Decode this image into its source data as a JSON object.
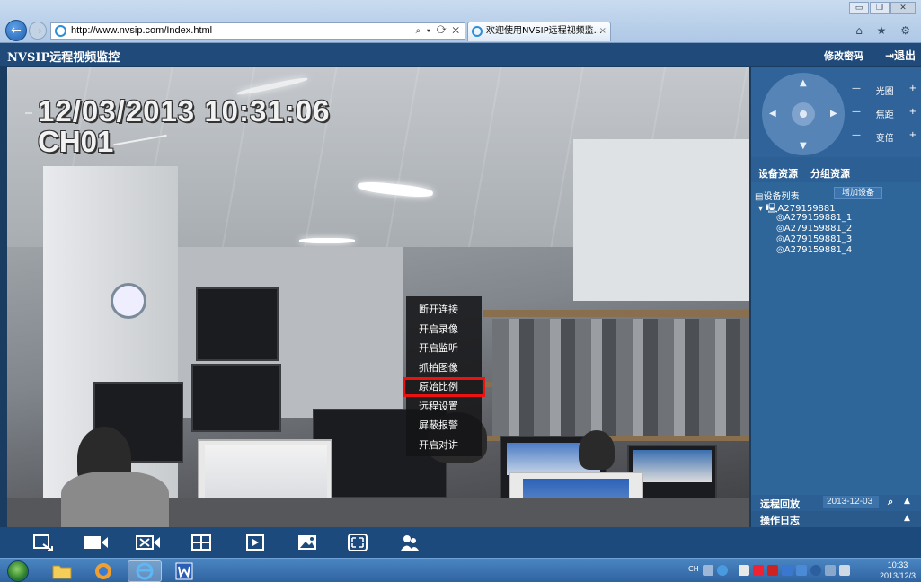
{
  "browser": {
    "address": "http://www.nvsip.com/Index.html",
    "address_tools": "⌕ ▾ ⟳ ✕",
    "tab_title": "欢迎使用NVSIP远程视频监...",
    "tab_close": "×",
    "min": "▭",
    "max": "❐",
    "close": "✕",
    "home_fav": "⌂ ★ ⚙"
  },
  "header": {
    "title": "NVSIP远程视频监控",
    "change_password": "修改密码",
    "logout": "⇥退出"
  },
  "video": {
    "osd_time": "12/03/2013 10:31:06",
    "osd_channel": "CH01"
  },
  "context_menu": {
    "items": [
      "断开连接",
      "开启录像",
      "开启监听",
      "抓拍图像",
      "原始比例",
      "远程设置",
      "屏蔽报警",
      "开启对讲"
    ],
    "highlighted_index": 4
  },
  "ptz": {
    "iris": {
      "minus": "—",
      "label": "光圈",
      "plus": "+"
    },
    "focus": {
      "minus": "—",
      "label": "焦距",
      "plus": "+"
    },
    "zoom": {
      "minus": "—",
      "label": "变倍",
      "plus": "+"
    }
  },
  "resources": {
    "tab_device": "设备资源",
    "tab_group": "分组资源",
    "device_list": "▤设备列表",
    "add_device": "增加设备",
    "root": "▾ 🖳A279159881",
    "channels": [
      "◎A279159881_1",
      "◎A279159881_2",
      "◎A279159881_3",
      "◎A279159881_4"
    ]
  },
  "playback": {
    "label": "远程回放",
    "date": "2013-12-03",
    "search": "⌕",
    "toggle": "▲"
  },
  "oplog": {
    "label": "操作日志",
    "toggle": "▲"
  },
  "toolbar": {
    "icons": [
      "exit-fullscreen-icon",
      "camera-icon",
      "stop-all-icon",
      "layout-4-icon",
      "play-icon",
      "snapshot-icon",
      "fullscreen-icon",
      "users-icon"
    ]
  },
  "taskbar": {
    "clock_time": "10:33",
    "clock_date": "2013/12/3",
    "lang": "CH"
  },
  "colors": {
    "accent": "#1f4a7a",
    "panel": "#2c5f94",
    "highlight": "#e11111"
  }
}
